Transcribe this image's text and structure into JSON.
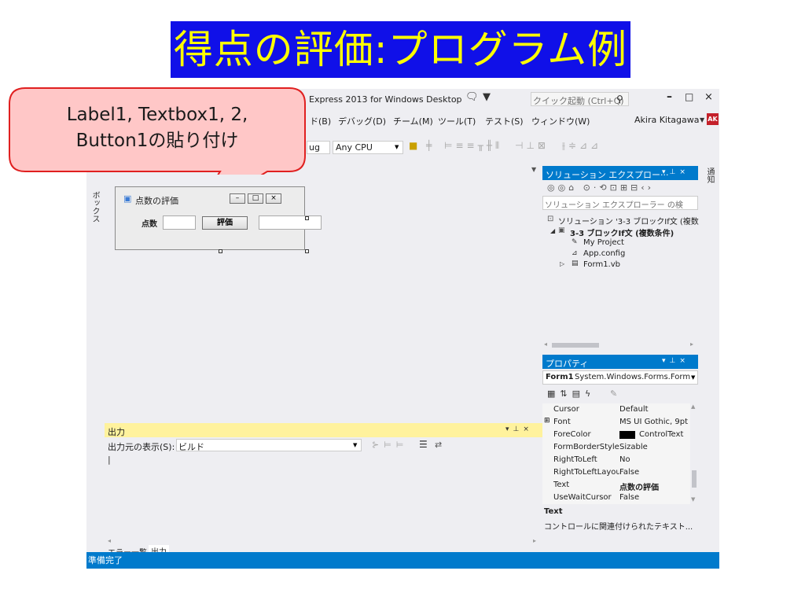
{
  "slide_title": "得点の評価:プログラム例",
  "callout": {
    "line1": "Label1, Textbox1, 2,",
    "line2": "Button1の貼り付け"
  },
  "ide": {
    "title": "Express 2013 for Windows Desktop",
    "quick_launch_placeholder": "クイック起動 (Ctrl+Q)",
    "user_name": "Akira Kitagawa",
    "user_initials": "AK",
    "menu": [
      "ド(B)",
      "デバッグ(D)",
      "チーム(M)",
      "ツール(T)",
      "テスト(S)",
      "ウィンドウ(W)"
    ],
    "toolbar": {
      "config": "ug",
      "platform": "Any CPU"
    },
    "toolbox_tab": "ボックス",
    "designer_form": {
      "title": "点数の評価",
      "label": "点数",
      "button": "評価"
    },
    "output": {
      "title": "出力",
      "source_label": "出力元の表示(S):",
      "source_value": "ビルド",
      "tabs": [
        "エラー一覧",
        "出力"
      ]
    },
    "solution": {
      "title": "ソリューション エクスプロー···",
      "search_placeholder": "ソリューション エクスプローラー の検",
      "tree": [
        "ソリューション '3-3 ブロックIf文 (複数",
        "3-3 ブロックIf文 (複数条件)",
        "My Project",
        "App.config",
        "Form1.vb"
      ]
    },
    "properties": {
      "title": "プロパティ",
      "object": "Form1",
      "object_type": "System.Windows.Forms.Form",
      "rows": [
        {
          "name": "Cursor",
          "value": "Default"
        },
        {
          "name": "Font",
          "value": "MS UI Gothic, 9pt"
        },
        {
          "name": "ForeColor",
          "value": "ControlText"
        },
        {
          "name": "FormBorderStyle",
          "value": "Sizable"
        },
        {
          "name": "RightToLeft",
          "value": "No"
        },
        {
          "name": "RightToLeftLayou",
          "value": "False"
        },
        {
          "name": "Text",
          "value": "点数の評価"
        },
        {
          "name": "UseWaitCursor",
          "value": "False"
        }
      ],
      "desc_title": "Text",
      "desc_text": "コントロールに関連付けられたテキスト..."
    },
    "side_tab": "通知",
    "status": "準備完了"
  },
  "colors": {
    "title_bg": "#1010e8",
    "title_fg": "#ffff00",
    "accent": "#007acc",
    "callout_fill": "#ffc7c7",
    "callout_border": "#e02020"
  }
}
